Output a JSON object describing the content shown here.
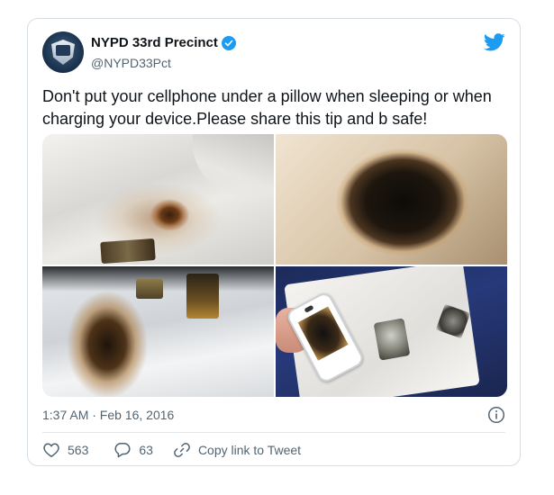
{
  "tweet": {
    "author_name": "NYPD 33rd Precinct",
    "author_handle": "@NYPD33Pct",
    "text": "Don't put your cellphone under a pillow when sleeping or when charging your device.Please share this tip and b safe!",
    "timestamp": "1:37 AM · Feb 16, 2016",
    "likes": "563",
    "replies": "63",
    "copy_link_label": "Copy link to Tweet",
    "verified": true
  },
  "icons": {
    "brand": "twitter-bird-icon",
    "verified": "verified-badge-icon",
    "info": "info-icon",
    "like": "heart-icon",
    "reply": "reply-icon",
    "link": "link-icon"
  },
  "colors": {
    "brand_blue": "#1d9bf0",
    "text_primary": "#0f1419",
    "text_secondary": "#536471",
    "border": "#d6dde3"
  }
}
